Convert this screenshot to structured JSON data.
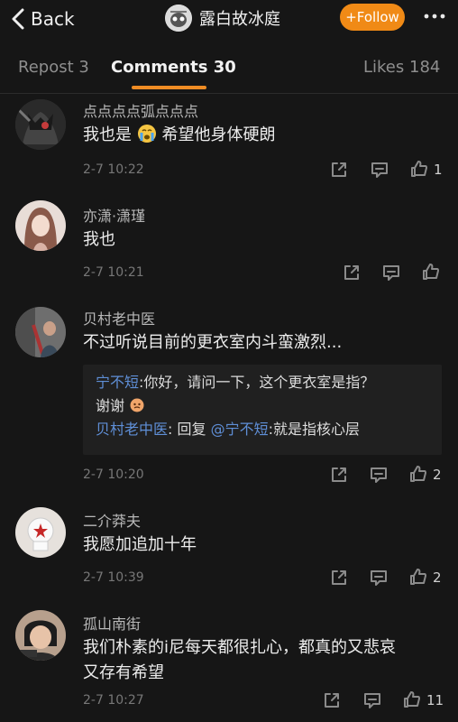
{
  "header": {
    "back_label": "Back",
    "title": "露白故冰庭",
    "follow_label": "+Follow"
  },
  "tabs": [
    {
      "label": "Repost 3"
    },
    {
      "label": "Comments 30"
    },
    {
      "label": "Likes 184"
    }
  ],
  "comments": [
    {
      "name": "点点点点弧点点点",
      "text_before": "我也是",
      "text_after": "希望他身体硬朗",
      "time": "2-7 10:22",
      "likes": "1"
    },
    {
      "name": "亦潇·潇瑾",
      "text": "我也",
      "time": "2-7 10:21",
      "likes": ""
    },
    {
      "name": "贝村老中医",
      "text": "不过听说目前的更衣室内斗蛮激烈...",
      "reply": {
        "line1_user": "宁不短",
        "line1_text": ":你好，请问一下，这个更衣室是指？",
        "line2_text": "谢谢",
        "line3_user": "贝村老中医",
        "line3_mid": ": 回复 ",
        "line3_mention": "@宁不短",
        "line3_text": ":就是指核心层"
      },
      "time": "2-7 10:20",
      "likes": "2"
    },
    {
      "name": "二介莽夫",
      "text": "我愿加追加十年",
      "time": "2-7 10:39",
      "likes": "2"
    },
    {
      "name": "孤山南街",
      "text_line1": "我们朴素的i尼每天都很扎心，都真的又悲哀",
      "text_line2": "又存有希望",
      "time": "2-7 10:27",
      "likes": "11"
    }
  ],
  "colors": {
    "accent": "#f08a16",
    "link": "#5f8fd7",
    "background": "#161616"
  }
}
